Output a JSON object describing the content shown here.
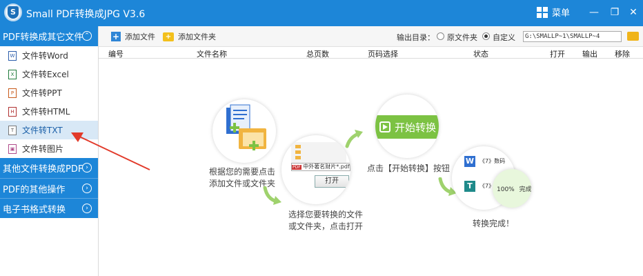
{
  "app": {
    "title": "Small PDF转换成JPG V3.6",
    "menu_label": "菜单"
  },
  "window_controls": {
    "minimize": "—",
    "maximize": "❐",
    "close": "✕"
  },
  "sidebar": {
    "categories": [
      {
        "label": "PDF转换成其它文件",
        "expanded": true,
        "items": [
          {
            "label": "文件转Word",
            "icon": "W"
          },
          {
            "label": "文件转Excel",
            "icon": "X"
          },
          {
            "label": "文件转PPT",
            "icon": "P"
          },
          {
            "label": "文件转HTML",
            "icon": "H"
          },
          {
            "label": "文件转TXT",
            "icon": "T",
            "active": true
          },
          {
            "label": "文件转图片",
            "icon": "I"
          }
        ]
      },
      {
        "label": "其他文件转换成PDF"
      },
      {
        "label": "PDF的其他操作"
      },
      {
        "label": "电子书格式转换"
      }
    ]
  },
  "toolbar": {
    "add_file": "添加文件",
    "add_folder": "添加文件夹",
    "output_label": "输出目录：",
    "opt_original": "原文件夹",
    "opt_custom": "自定义",
    "custom_selected": true,
    "path_value": "G:\\SMALLP~1\\SMALLP~4"
  },
  "table": {
    "headers": [
      "编号",
      "文件名称",
      "总页数",
      "页码选择",
      "状态",
      "打开",
      "输出",
      "移除"
    ]
  },
  "guide": {
    "step1": [
      "根据您的需要点击",
      "添加文件或文件夹"
    ],
    "step2_dialog_file": "中外著名财片*.pdf;*.",
    "step2_dialog_button": "打开",
    "step2": [
      "选择您要转换的文件",
      "或文件夹，点击打开"
    ],
    "start_button": "开始转换",
    "step3": "点击【开始转换】按钮",
    "result_items": [
      "《7》数码",
      "《7》"
    ],
    "result_progress": "100%",
    "result_status": "完成",
    "step4": "转换完成！"
  },
  "colors": {
    "brand": "#1d86d8",
    "active_bg": "#d8e8f6",
    "green": "#7cc243"
  }
}
